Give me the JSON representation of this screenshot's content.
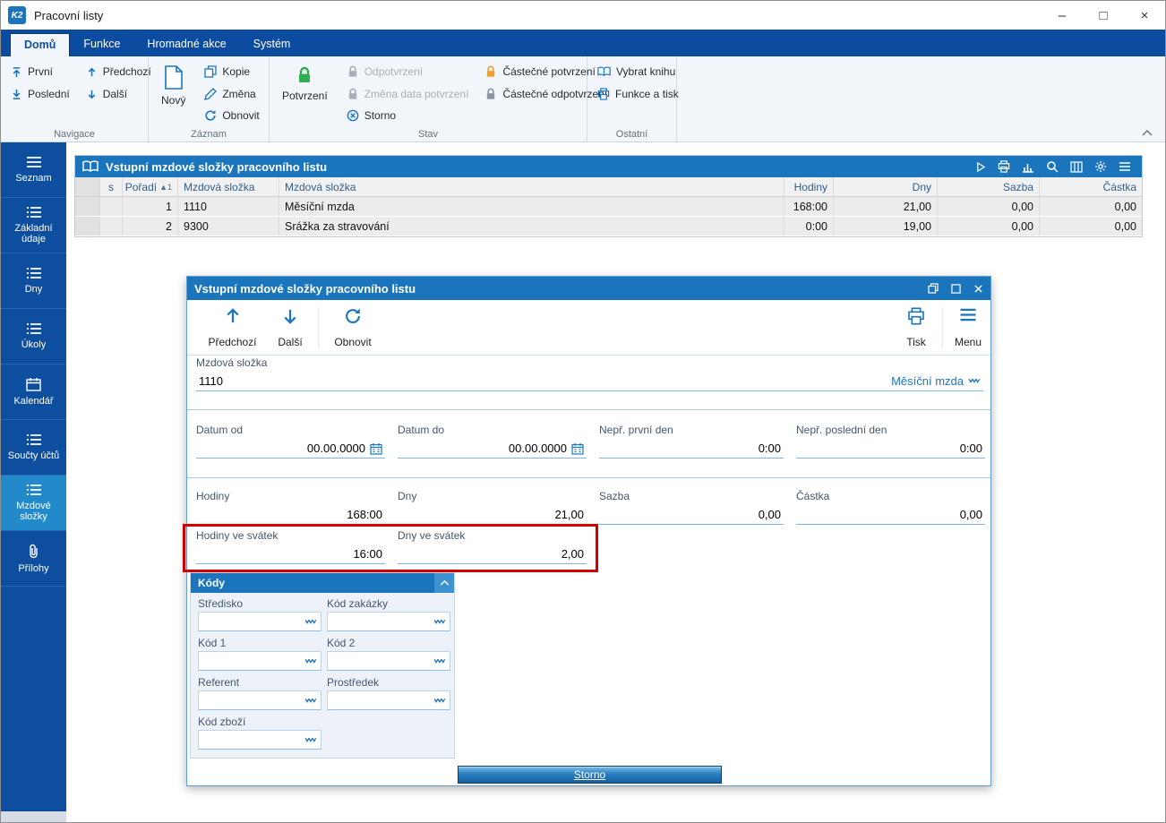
{
  "window": {
    "title": "Pracovní listy",
    "logo": "K2",
    "minimize": "–",
    "maximize": "□",
    "close": "×"
  },
  "ribbon": {
    "tabs": [
      {
        "label": "Domů",
        "active": true
      },
      {
        "label": "Funkce",
        "active": false
      },
      {
        "label": "Hromadné akce",
        "active": false
      },
      {
        "label": "Systém",
        "active": false
      }
    ],
    "groups": {
      "navigace": {
        "label": "Navigace",
        "prvni": "První",
        "posledni": "Poslední",
        "predchozi": "Předchozí",
        "dalsi": "Další"
      },
      "zaznam": {
        "label": "Záznam",
        "novy": "Nový",
        "kopie": "Kopie",
        "zmena": "Změna",
        "obnovit": "Obnovit"
      },
      "stav": {
        "label": "Stav",
        "potvrzeni": "Potvrzení",
        "odpotvrzeni": "Odpotvrzení",
        "zmena_data": "Změna data potvrzení",
        "storno": "Storno",
        "castecne_potvrzeni": "Částečné potvrzení",
        "castecne_odpotvrzeni": "Částečné odpotvrzení"
      },
      "ostatni": {
        "label": "Ostatní",
        "vybrat_knihu": "Vybrat knihu",
        "funkce_a_tisk": "Funkce a tisk"
      }
    }
  },
  "sidebar": {
    "items": [
      {
        "label": "Seznam",
        "icon": "menu-icon",
        "active": false
      },
      {
        "label": "Základní údaje",
        "icon": "list-icon",
        "active": false
      },
      {
        "label": "Dny",
        "icon": "list-icon",
        "active": false
      },
      {
        "label": "Úkoly",
        "icon": "list-icon",
        "active": false
      },
      {
        "label": "Kalendář",
        "icon": "calendar-icon",
        "active": false
      },
      {
        "label": "Součty účtů",
        "icon": "list-icon",
        "active": false
      },
      {
        "label": "Mzdové složky",
        "icon": "list-icon",
        "active": true
      },
      {
        "label": "Přílohy",
        "icon": "paperclip-icon",
        "active": false
      }
    ]
  },
  "grid": {
    "title": "Vstupní mzdové složky pracovního listu",
    "header": {
      "s": "s",
      "poradi": "Pořadí",
      "sort": "▲1",
      "kod": "Mzdová složka",
      "nazev": "Mzdová složka",
      "hodiny": "Hodiny",
      "dny": "Dny",
      "sazba": "Sazba",
      "castka": "Částka"
    },
    "rows": [
      {
        "poradi": "1",
        "kod": "1110",
        "nazev": "Měsíční mzda",
        "hodiny": "168:00",
        "dny": "21,00",
        "sazba": "0,00",
        "castka": "0,00"
      },
      {
        "poradi": "2",
        "kod": "9300",
        "nazev": "Srážka za stravování",
        "hodiny": "0:00",
        "dny": "19,00",
        "sazba": "0,00",
        "castka": "0,00"
      }
    ]
  },
  "dialog": {
    "title": "Vstupní mzdové složky pracovního listu",
    "toolbar": {
      "predchozi": "Předchozí",
      "dalsi": "Další",
      "obnovit": "Obnovit",
      "tisk": "Tisk",
      "menu": "Menu"
    },
    "slozka": {
      "label": "Mzdová složka",
      "value": "1110",
      "display": "Měsíční mzda"
    },
    "row1": [
      {
        "label": "Datum od",
        "value": "00.00.0000"
      },
      {
        "label": "Datum do",
        "value": "00.00.0000"
      },
      {
        "label": "Nepř. první den",
        "value": "0:00"
      },
      {
        "label": "Nepř. poslední den",
        "value": "0:00"
      }
    ],
    "row2": [
      {
        "label": "Hodiny",
        "value": "168:00"
      },
      {
        "label": "Dny",
        "value": "21,00"
      },
      {
        "label": "Sazba",
        "value": "0,00"
      },
      {
        "label": "Částka",
        "value": "0,00"
      }
    ],
    "row3": [
      {
        "label": "Hodiny ve svátek",
        "value": "16:00"
      },
      {
        "label": "Dny ve svátek",
        "value": "2,00"
      }
    ],
    "kody": {
      "title": "Kódy",
      "fields": [
        {
          "label": "Středisko"
        },
        {
          "label": "Kód zakázky"
        },
        {
          "label": "Kód 1"
        },
        {
          "label": "Kód 2"
        },
        {
          "label": "Referent"
        },
        {
          "label": "Prostředek"
        },
        {
          "label": "Kód zboží"
        }
      ]
    },
    "storno": "Storno"
  },
  "colors": {
    "accent": "#1a75bc",
    "sidebar": "#0d4f9e",
    "green": "#2fae53",
    "orange": "#f0a030",
    "annotation": "#d40000"
  }
}
